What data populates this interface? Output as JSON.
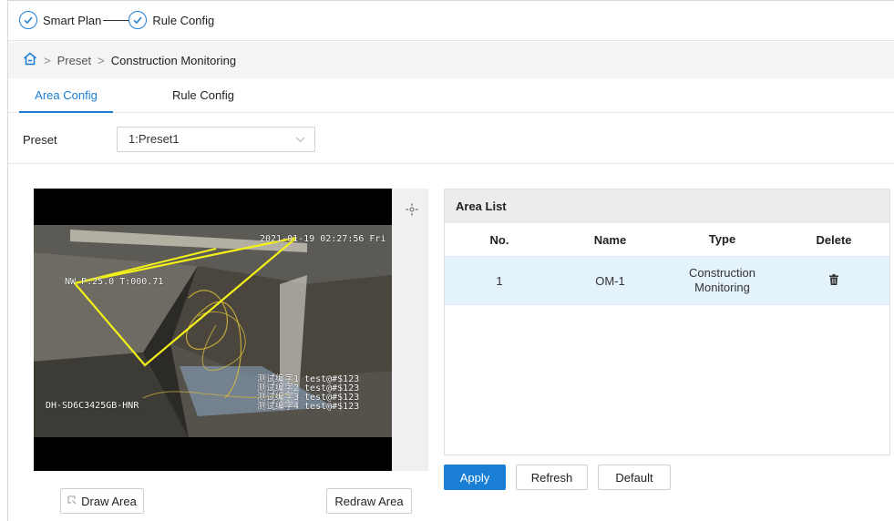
{
  "steps": [
    {
      "label": "Smart Plan"
    },
    {
      "label": "Rule Config"
    }
  ],
  "breadcrumb": {
    "sep1": ">",
    "item1": "Preset",
    "sep2": ">",
    "item2": "Construction Monitoring"
  },
  "tabs": {
    "active": "Area Config",
    "other": "Rule Config"
  },
  "preset": {
    "label": "Preset",
    "value": "1:Preset1"
  },
  "video": {
    "timestamp": "2021-01-19 02:27:56 Fri",
    "left_label": "NW   P:25.0 T:000.71",
    "device_label": "DH-SD6C3425GB-HNR",
    "osd_lines": [
      "测试编字1 test@#$123",
      "测试编字2 test@#$123",
      "测试编字3 test@#$123",
      "测试编字4 test@#$123"
    ]
  },
  "buttons": {
    "draw_area": "Draw Area",
    "redraw_area": "Redraw Area",
    "apply": "Apply",
    "refresh": "Refresh",
    "default": "Default"
  },
  "area_list": {
    "title": "Area List",
    "columns": [
      "No.",
      "Name",
      "Type",
      "Delete"
    ],
    "rows": [
      {
        "no": "1",
        "name": "OM-1",
        "type": "Construction Monitoring"
      }
    ]
  },
  "colors": {
    "accent": "#1a7fd4",
    "row_highlight": "#e4f2fc",
    "area_line": "#f4f11a"
  }
}
